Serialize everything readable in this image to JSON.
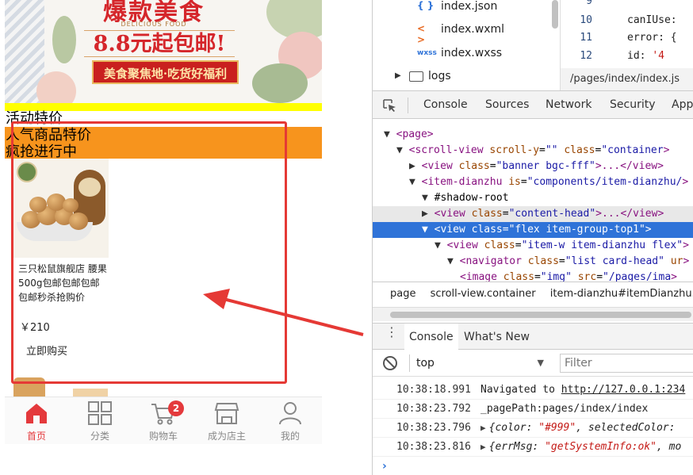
{
  "phone": {
    "banner": {
      "title": "爆款美食",
      "subtitle": "DELICIOUS FOOD",
      "price": "8.8元起包邮!",
      "slogan": "美食聚焦地·吃货好福利"
    },
    "overlay_texts": [
      "活动特价",
      "人气商品特价",
      "疯抢进行中"
    ],
    "product": {
      "image_icon": "walnut-squirrel-product-image",
      "title": "三只松鼠旗舰店 腰果500g包邮包邮包邮包邮秒杀抢购价",
      "price": "￥210",
      "buy_label": "立即购买"
    },
    "tabbar": {
      "tabs": [
        {
          "label": "首页",
          "icon": "home-icon",
          "active": true
        },
        {
          "label": "分类",
          "icon": "grid-icon",
          "active": false
        },
        {
          "label": "购物车",
          "icon": "cart-icon",
          "active": false,
          "badge": "2"
        },
        {
          "label": "成为店主",
          "icon": "shop-icon",
          "active": false
        },
        {
          "label": "我的",
          "icon": "user-icon",
          "active": false
        }
      ]
    },
    "highlight_color": "#e53935",
    "accent_color": "#e4393c"
  },
  "devtools": {
    "files": [
      {
        "icon": "{ }",
        "name": "index.json"
      },
      {
        "icon": "< >",
        "name": "index.wxml"
      },
      {
        "icon": "wxss",
        "name": "index.wxss"
      }
    ],
    "folder": {
      "name": "logs"
    },
    "code_lines": [
      {
        "num": "9",
        "text": "",
        "str": ""
      },
      {
        "num": "10",
        "text": "canIUse:",
        "str": ""
      },
      {
        "num": "11",
        "text": "error: {",
        "str": ""
      },
      {
        "num": "12",
        "text": "  id: ",
        "str": "'4"
      }
    ],
    "code_path": "/pages/index/index.js",
    "tabs": [
      "Console",
      "Sources",
      "Network",
      "Security",
      "App"
    ],
    "elements": [
      {
        "indent": 1,
        "tri": "▼",
        "html": "<page>"
      },
      {
        "indent": 2,
        "tri": "▼",
        "tag": "scroll-view",
        "attrs": [
          [
            "scroll-y",
            "\"\""
          ],
          [
            "class",
            "\"container"
          ]
        ]
      },
      {
        "indent": 3,
        "tri": "▶",
        "tag": "view",
        "attrs": [
          [
            "class",
            "\"banner bgc-fff\""
          ]
        ],
        "tail": "...</view>"
      },
      {
        "indent": 3,
        "tri": "▼",
        "tag": "item-dianzhu",
        "attrs": [
          [
            "is",
            "\"components/item-dianzhu/"
          ]
        ]
      },
      {
        "indent": 4,
        "tri": "▼",
        "plain": "#shadow-root"
      },
      {
        "indent": 4,
        "tri": "▶",
        "tag": "view",
        "attrs": [
          [
            "class",
            "\"content-head\""
          ]
        ],
        "tail": "...</view>",
        "state": "hover"
      },
      {
        "indent": 4,
        "tri": "▼",
        "tag": "view",
        "attrs": [
          [
            "class",
            "\"flex item-group-top1\""
          ]
        ],
        "state": "selected"
      },
      {
        "indent": 5,
        "tri": "▼",
        "tag": "view",
        "attrs": [
          [
            "class",
            "\"item-w item-dianzhu flex\""
          ]
        ]
      },
      {
        "indent": 6,
        "tri": "▼",
        "tag": "navigator",
        "attrs": [
          [
            "class",
            "\"list card-head\""
          ],
          [
            "ur",
            ""
          ]
        ]
      },
      {
        "indent": 7,
        "tri": "",
        "tag": "image",
        "attrs": [
          [
            "class",
            "\"img\""
          ],
          [
            "src",
            "\"/pages/ima"
          ]
        ]
      }
    ],
    "breadcrumbs": [
      "page",
      "scroll-view.container",
      "item-dianzhu#itemDianzhu.m"
    ],
    "drawer_tabs": [
      "Console",
      "What's New"
    ],
    "console_context": "top",
    "filter_placeholder": "Filter",
    "logs": [
      {
        "ts": "10:38:18.991",
        "msg": "Navigated to ",
        "link": "http://127.0.0.1:234"
      },
      {
        "ts": "10:38:23.792",
        "msg": "_pagePath:pages/index/index"
      },
      {
        "ts": "10:38:23.796",
        "obj": true,
        "k1": "color",
        "v1": "\"#999\"",
        "k2": "selectedColor"
      },
      {
        "ts": "10:38:23.816",
        "obj": true,
        "k1": "errMsg",
        "v1": "\"getSystemInfo:ok\"",
        "k2": "mo"
      }
    ],
    "selection_color": "#2f73d8"
  }
}
